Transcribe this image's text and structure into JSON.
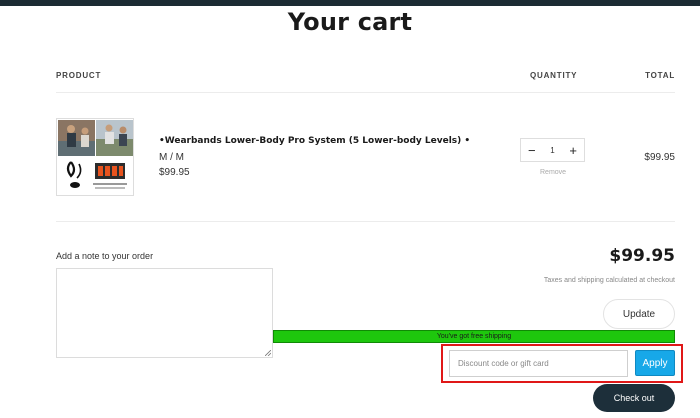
{
  "page": {
    "title": "Your cart"
  },
  "table": {
    "headers": {
      "product": "PRODUCT",
      "quantity": "QUANTITY",
      "total": "TOTAL"
    }
  },
  "item": {
    "title": "•Wearbands Lower-Body Pro System (5 Lower-body Levels) •",
    "variant": "M / M",
    "price": "$99.95",
    "quantity": "1",
    "decrement": "−",
    "increment": "+",
    "remove_label": "Remove",
    "line_total": "$99.95"
  },
  "note": {
    "label": "Add a note to your order"
  },
  "summary": {
    "subtotal": "$99.95",
    "tax_note": "Taxes and shipping calculated at checkout",
    "update_label": "Update",
    "shipping_message": "You've got free shipping",
    "discount_placeholder": "Discount code or gift card",
    "apply_label": "Apply",
    "checkout_label": "Check out"
  },
  "colors": {
    "topbar": "#1c2b33",
    "shipping_bar": "#1ec70d",
    "apply_button": "#17a8e8",
    "checkout_button": "#1d2f3a",
    "highlight_frame": "#e01818"
  }
}
